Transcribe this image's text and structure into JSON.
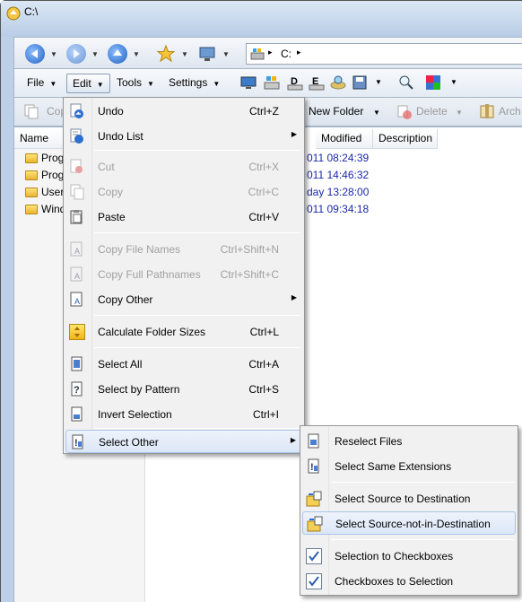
{
  "window": {
    "title": "C:\\"
  },
  "address": {
    "path": "C:",
    "sep": "▸"
  },
  "menubar": {
    "file": "File",
    "edit": "Edit",
    "tools": "Tools",
    "settings": "Settings",
    "dropdown": "▼"
  },
  "actionbar": {
    "copy": "Cop",
    "new_folder": "New Folder",
    "delete": "Delete",
    "archive": "Arch"
  },
  "columns": {
    "name": "Name",
    "modified": "Modified",
    "description": "Description"
  },
  "files": [
    {
      "name": "Prog",
      "date": "011  08:24:39"
    },
    {
      "name": "Prog",
      "date": "011  14:46:32"
    },
    {
      "name": "Users",
      "date": "day  13:28:00"
    },
    {
      "name": "Windo",
      "date": "011  09:34:18"
    }
  ],
  "edit_menu": {
    "undo": {
      "label": "Undo",
      "shortcut": "Ctrl+Z"
    },
    "undo_list": {
      "label": "Undo List"
    },
    "cut": {
      "label": "Cut",
      "shortcut": "Ctrl+X"
    },
    "copy": {
      "label": "Copy",
      "shortcut": "Ctrl+C"
    },
    "paste": {
      "label": "Paste",
      "shortcut": "Ctrl+V"
    },
    "copy_file_names": {
      "label": "Copy File Names",
      "shortcut": "Ctrl+Shift+N"
    },
    "copy_full_pathnames": {
      "label": "Copy Full Pathnames",
      "shortcut": "Ctrl+Shift+C"
    },
    "copy_other": {
      "label": "Copy Other"
    },
    "calc_folder_sizes": {
      "label": "Calculate Folder Sizes",
      "shortcut": "Ctrl+L"
    },
    "select_all": {
      "label": "Select All",
      "shortcut": "Ctrl+A"
    },
    "select_by_pattern": {
      "label": "Select by Pattern",
      "shortcut": "Ctrl+S"
    },
    "invert_selection": {
      "label": "Invert Selection",
      "shortcut": "Ctrl+I"
    },
    "select_other": {
      "label": "Select Other"
    },
    "submenu_arrow": "▶"
  },
  "select_other_menu": {
    "reselect_files": "Reselect Files",
    "select_same_extensions": "Select Same Extensions",
    "select_source_to_destination": "Select Source to Destination",
    "select_source_not_in_destination": "Select Source-not-in-Destination",
    "selection_to_checkboxes": "Selection to Checkboxes",
    "checkboxes_to_selection": "Checkboxes to Selection"
  }
}
